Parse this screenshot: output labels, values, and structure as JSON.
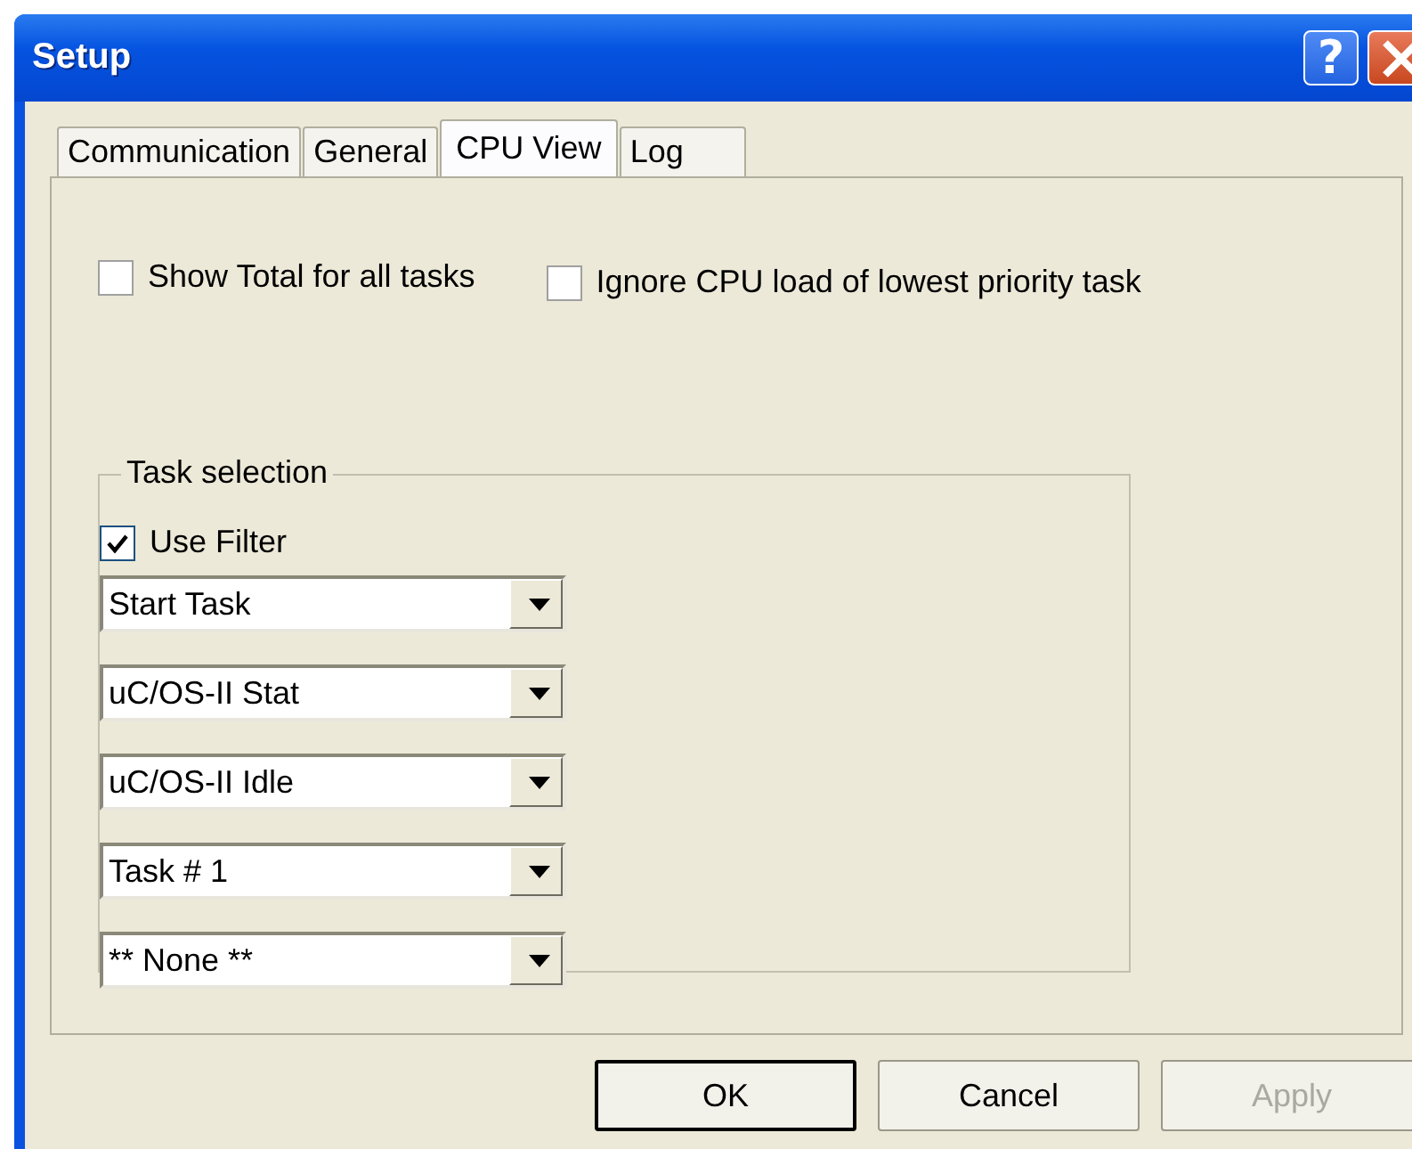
{
  "window": {
    "title": "Setup",
    "help_button": "?"
  },
  "tabs": [
    {
      "label": "Communication",
      "selected": false
    },
    {
      "label": "General",
      "selected": false
    },
    {
      "label": "CPU View",
      "selected": true
    },
    {
      "label": "Log",
      "selected": false
    }
  ],
  "options": [
    {
      "label": "Show Total for all tasks",
      "checked": false
    },
    {
      "label": "Ignore CPU load of lowest priority task",
      "checked": false
    }
  ],
  "task_selection": {
    "title": "Task selection",
    "use_filter": {
      "label": "Use Filter",
      "checked": true
    },
    "dropdowns": [
      {
        "value": "Start Task"
      },
      {
        "value": "uC/OS-II Stat"
      },
      {
        "value": "uC/OS-II Idle"
      },
      {
        "value": "Task # 1"
      },
      {
        "value": "** None **"
      }
    ]
  },
  "buttons": [
    {
      "label": "OK",
      "default": true,
      "disabled": false
    },
    {
      "label": "Cancel",
      "default": false,
      "disabled": false
    },
    {
      "label": "Apply",
      "default": false,
      "disabled": true
    }
  ]
}
